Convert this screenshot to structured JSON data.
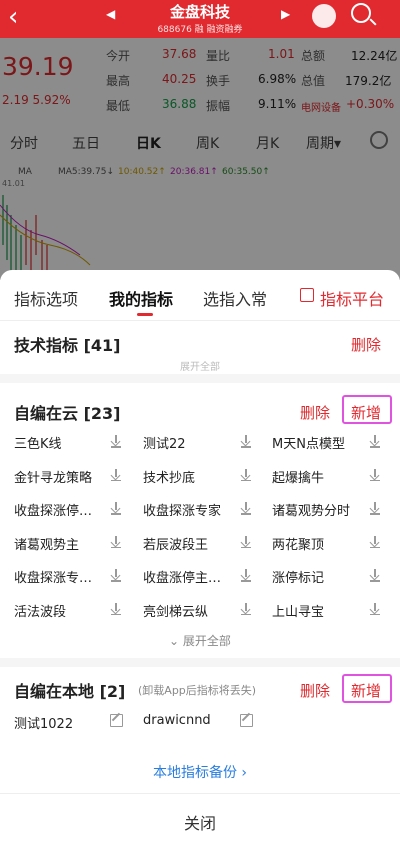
{
  "header": {
    "back": "‹",
    "prev": "◀",
    "next": "▶",
    "name": "金盘科技",
    "code": "688676 融 融资融券"
  },
  "quote": {
    "price": "39.19",
    "change": "2.19 5.92%",
    "row1": {
      "k1": "今开",
      "v1": "37.68",
      "k2": "量比",
      "v2": "1.01",
      "k3": "总额",
      "v3": "12.24亿"
    },
    "row2": {
      "k1": "最高",
      "v1": "40.25",
      "k2": "换手",
      "v2": "6.98%",
      "k3": "总值",
      "v3": "179.2亿"
    },
    "row3": {
      "k1": "最低",
      "v1": "36.88",
      "k2": "振幅",
      "v2": "9.11%",
      "k3": "电网设备",
      "v3": "+0.30%"
    }
  },
  "periods": [
    "分时",
    "五日",
    "日K",
    "周K",
    "月K",
    "周期▾"
  ],
  "ma": {
    "label": "MA",
    "ma5": "MA5:39.75↓",
    "ma10": "10:40.52↑",
    "ma20": "20:36.81↑",
    "ma60": "60:35.50↑",
    "axis_top": "41.01"
  },
  "colors": {
    "accent": "#e02a2f",
    "link": "#2a7ee0",
    "highlight": "#e052e0"
  },
  "sheet": {
    "tabs": [
      "指标选项",
      "我的指标",
      "选指入常"
    ],
    "platform": "指标平台",
    "tech": {
      "title": "技术指标 [41]",
      "delete": "删除",
      "expand_hidden": "展开全部"
    },
    "cloud": {
      "title": "自编在云 [23]",
      "delete": "删除",
      "add": "新增",
      "items": [
        "三色K线",
        "测试22",
        "M天N点模型",
        "金针寻龙策略",
        "技术抄底",
        "起爆擒牛",
        "收盘探涨停…",
        "收盘探涨专家",
        "诸葛观势分时",
        "诸葛观势主",
        "若辰波段王",
        "两花聚顶",
        "收盘探涨专…",
        "收盘涨停主…",
        "涨停标记",
        "活法波段",
        "亮剑梯云纵",
        "上山寻宝"
      ],
      "expand": "展开全部"
    },
    "local": {
      "title": "自编在本地 [2]",
      "note": "(卸载App后指标将丢失)",
      "delete": "删除",
      "add": "新增",
      "items": [
        "测试1022",
        "drawicnnd"
      ]
    },
    "backup": "本地指标备份",
    "close": "关闭"
  }
}
